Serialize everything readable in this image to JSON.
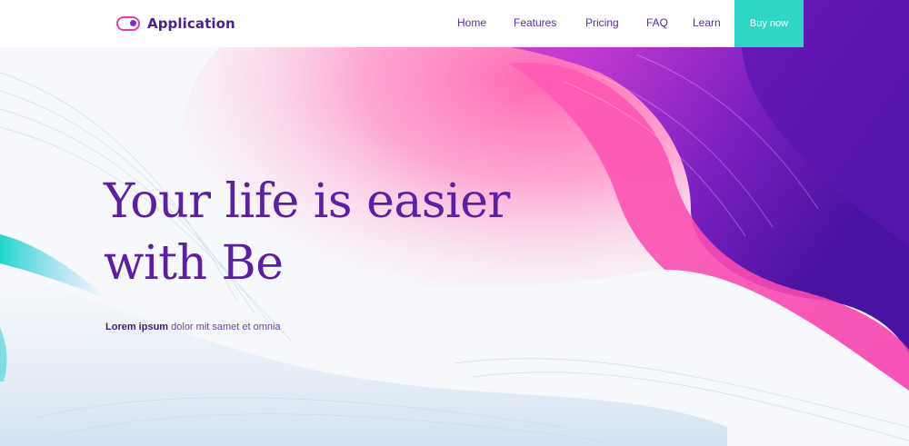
{
  "brand": {
    "name": "Application",
    "icon": "toggle-icon"
  },
  "nav": {
    "items": [
      {
        "label": "Home"
      },
      {
        "label": "Features"
      },
      {
        "label": "Pricing"
      },
      {
        "label": "FAQ"
      },
      {
        "label": "Learn"
      }
    ],
    "cta_label": "Buy now"
  },
  "hero": {
    "title_line1": "Your life is easier",
    "title_line2": "with Be",
    "subtitle_bold": "Lorem ipsum",
    "subtitle_rest": " dolor mit samet et omnia"
  },
  "colors": {
    "brand_purple": "#5b1fa6",
    "accent_pink": "#f050b8",
    "accent_teal": "#2fd6c8",
    "deep_purple": "#4a12a0"
  }
}
